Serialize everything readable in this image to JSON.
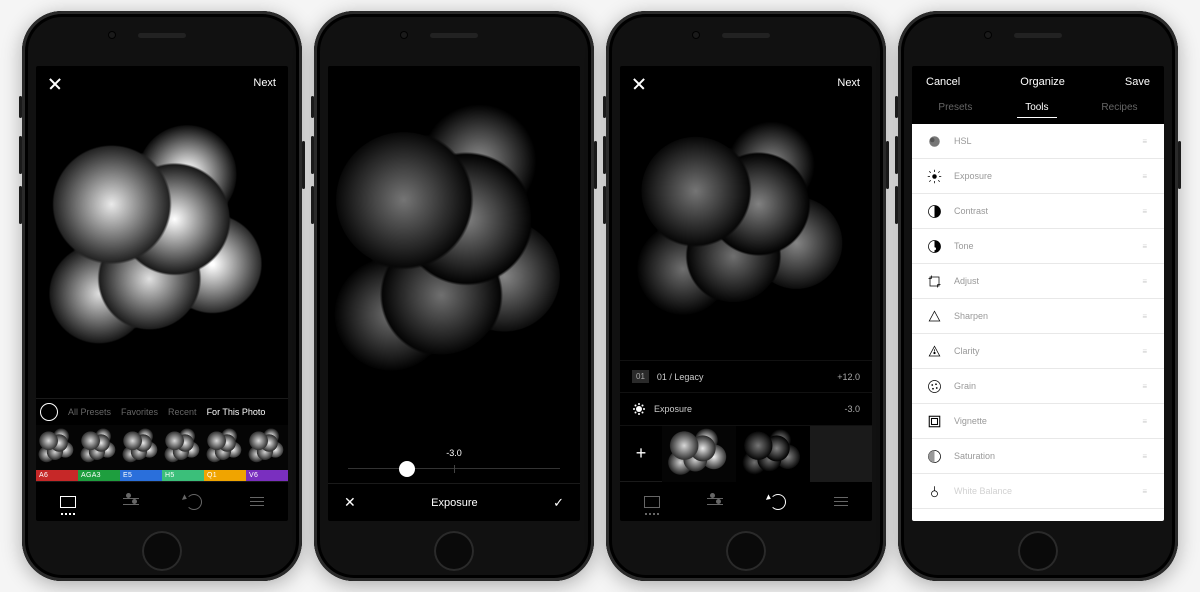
{
  "screen1": {
    "close": "Close",
    "next": "Next",
    "tabs": {
      "all": "All Presets",
      "favorites": "Favorites",
      "recent": "Recent",
      "forThis": "For This Photo"
    },
    "presets": [
      {
        "label": "A6",
        "color": "#c62828"
      },
      {
        "label": "AGA3",
        "color": "#1e9e3e"
      },
      {
        "label": "E5",
        "color": "#2a6fdb"
      },
      {
        "label": "H5",
        "color": "#3bbf7a"
      },
      {
        "label": "Q1",
        "color": "#f0a400"
      },
      {
        "label": "V6",
        "color": "#7a2fbf"
      }
    ]
  },
  "screen2": {
    "value": "-3.0",
    "tool": "Exposure"
  },
  "screen3": {
    "close": "Close",
    "next": "Next",
    "rows": [
      {
        "badge": "01",
        "name": "01 / Legacy",
        "value": "+12.0"
      },
      {
        "name": "Exposure",
        "value": "-3.0"
      }
    ]
  },
  "screen4": {
    "cancel": "Cancel",
    "title": "Organize",
    "save": "Save",
    "tabs": {
      "presets": "Presets",
      "tools": "Tools",
      "recipes": "Recipes"
    },
    "tools": [
      "HSL",
      "Exposure",
      "Contrast",
      "Tone",
      "Adjust",
      "Sharpen",
      "Clarity",
      "Grain",
      "Vignette",
      "Saturation",
      "White Balance"
    ]
  }
}
